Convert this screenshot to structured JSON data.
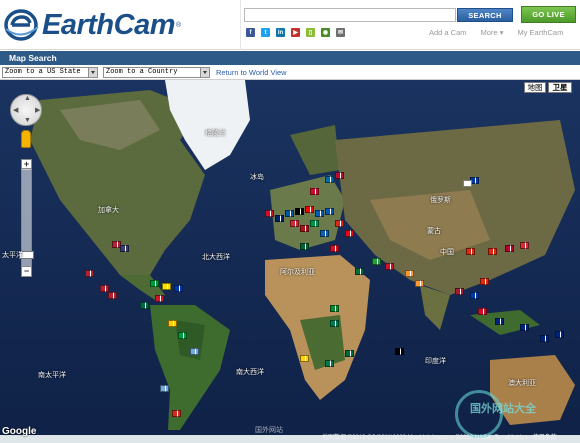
{
  "header": {
    "logo_text": "EarthCam",
    "logo_reg": "®",
    "search_placeholder": "",
    "search_button": "SEARCH",
    "golive_button": "GO LIVE",
    "social_icons": [
      "facebook-icon",
      "twitter-icon",
      "linkedin-icon",
      "youtube-icon",
      "mobile-icon",
      "rss-icon",
      "email-icon"
    ],
    "links": [
      "Add a Cam",
      "More ▾",
      "My EarthCam"
    ]
  },
  "titlebar": {
    "title": "Map Search"
  },
  "controls": {
    "us_state_select": "Zoom to a US State",
    "country_select": "Zoom to a Country",
    "world_link": "Return to World View"
  },
  "map": {
    "type_buttons": [
      "地图",
      "卫星"
    ],
    "labels": {
      "north_atlantic": "北大西洋",
      "south_atlantic": "南大西洋",
      "south_pacific": "南太平洋",
      "indian_ocean": "印度洋",
      "pacific_left": "太平洋",
      "greenland": "格陵兰",
      "iceland": "冰岛",
      "canada": "加拿大",
      "china": "中国",
      "russia": "俄罗斯",
      "mongolia": "蒙古",
      "africa": "阿尔及利亚",
      "australia": "澳大利亚"
    },
    "google_logo": "Google",
    "copyright": "地图数据 ©2013 GS(2011)6020 MapLink Imagery ©2013 NASA, TerraMetrics · 使用条款",
    "watermark": "国外网站大全",
    "watermark2": "国外网站"
  },
  "colors": {
    "brand": "#1b4f8a",
    "titlebar": "#2d5a86",
    "search": "#2a5fa0",
    "golive": "#4d9a2a"
  }
}
